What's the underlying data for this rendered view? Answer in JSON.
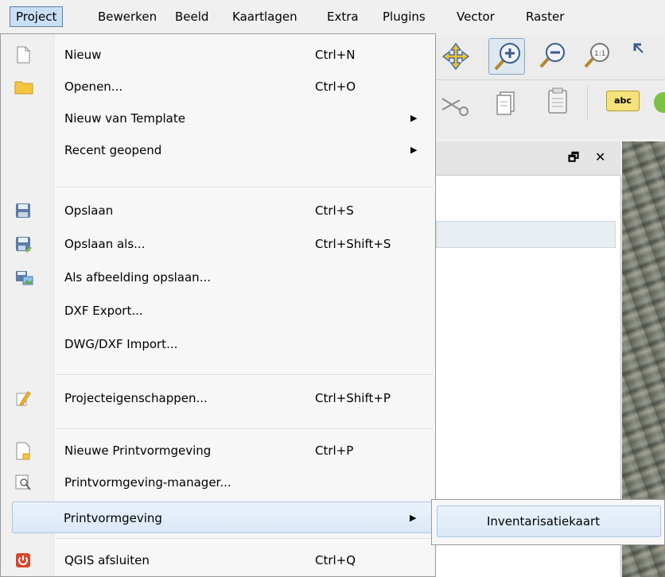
{
  "menubar": {
    "items": [
      "Project",
      "Bewerken",
      "Beeld",
      "Kaartlagen",
      "Extra",
      "Plugins",
      "Vector",
      "Raster"
    ]
  },
  "project_menu": {
    "items": [
      {
        "label": "Nieuw",
        "shortcut": "Ctrl+N",
        "icon": "new-file-icon"
      },
      {
        "label": "Openen...",
        "shortcut": "Ctrl+O",
        "icon": "folder-icon"
      },
      {
        "label": "Nieuw van Template",
        "shortcut": "",
        "icon": ""
      },
      {
        "label": "Recent geopend",
        "shortcut": "",
        "icon": ""
      },
      {
        "label": "Opslaan",
        "shortcut": "Ctrl+S",
        "icon": "save-icon"
      },
      {
        "label": "Opslaan als...",
        "shortcut": "Ctrl+Shift+S",
        "icon": "save-as-icon"
      },
      {
        "label": "Als afbeelding opslaan...",
        "shortcut": "",
        "icon": "save-image-icon"
      },
      {
        "label": "DXF Export...",
        "shortcut": "",
        "icon": ""
      },
      {
        "label": "DWG/DXF Import...",
        "shortcut": "",
        "icon": ""
      },
      {
        "label": "Projecteigenschappen...",
        "shortcut": "Ctrl+Shift+P",
        "icon": "properties-icon"
      },
      {
        "label": "Nieuwe Printvormgeving",
        "shortcut": "Ctrl+P",
        "icon": "new-print-layout-icon"
      },
      {
        "label": "Printvormgeving-manager...",
        "shortcut": "",
        "icon": "layout-manager-icon"
      },
      {
        "label": "Printvormgeving",
        "shortcut": "",
        "icon": ""
      },
      {
        "label": "QGIS afsluiten",
        "shortcut": "Ctrl+Q",
        "icon": "exit-icon"
      }
    ]
  },
  "submenu": {
    "items": [
      {
        "label": "Inventarisatiekaart"
      }
    ]
  },
  "toolbar": {
    "icons": [
      "pan-map-icon",
      "zoom-in-icon",
      "zoom-out-icon",
      "zoom-native-icon",
      "zoom-full-icon",
      "cut-icon",
      "copy-icon",
      "paste-icon",
      "label-icon",
      "add-layer-icon"
    ],
    "label_text": "abc"
  },
  "dock": {
    "float_glyph": "🗗",
    "close_glyph": "✕"
  },
  "colors": {
    "highlight": "#dbe8f6",
    "highlight_border": "#a9c6e6",
    "menu_bg": "#f7f7f7"
  }
}
